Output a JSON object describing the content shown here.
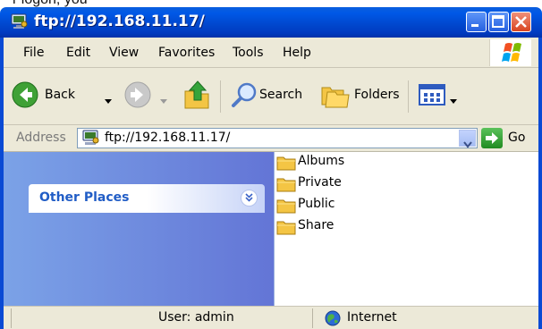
{
  "window": {
    "title": "ftp://192.168.11.17/",
    "top_crop_text": "r logon, you"
  },
  "menubar": {
    "items": [
      "File",
      "Edit",
      "View",
      "Favorites",
      "Tools",
      "Help"
    ]
  },
  "toolbar": {
    "back_label": "Back",
    "search_label": "Search",
    "folders_label": "Folders"
  },
  "address": {
    "label": "Address",
    "value": "ftp://192.168.11.17/",
    "go_label": "Go"
  },
  "taskpane": {
    "other_places_title": "Other Places"
  },
  "files": [
    {
      "name": "Albums"
    },
    {
      "name": "Private"
    },
    {
      "name": "Public"
    },
    {
      "name": "Share"
    }
  ],
  "status": {
    "user": "User: admin",
    "zone": "Internet"
  },
  "colors": {
    "titlebar": "#0058e6",
    "taskpane": "#7ba2e7",
    "chrome": "#ece9d8",
    "link_blue": "#215dc6",
    "folder": "#f4c544"
  },
  "icons": {
    "title": "ftp-computer-icon",
    "back": "back-arrow-icon",
    "forward": "forward-arrow-icon",
    "up": "up-folder-icon",
    "search": "search-magnifier-icon",
    "folders": "folders-icon",
    "views": "views-icon",
    "go": "go-arrow-icon",
    "internet": "globe-icon",
    "folder_item": "folder-icon"
  }
}
